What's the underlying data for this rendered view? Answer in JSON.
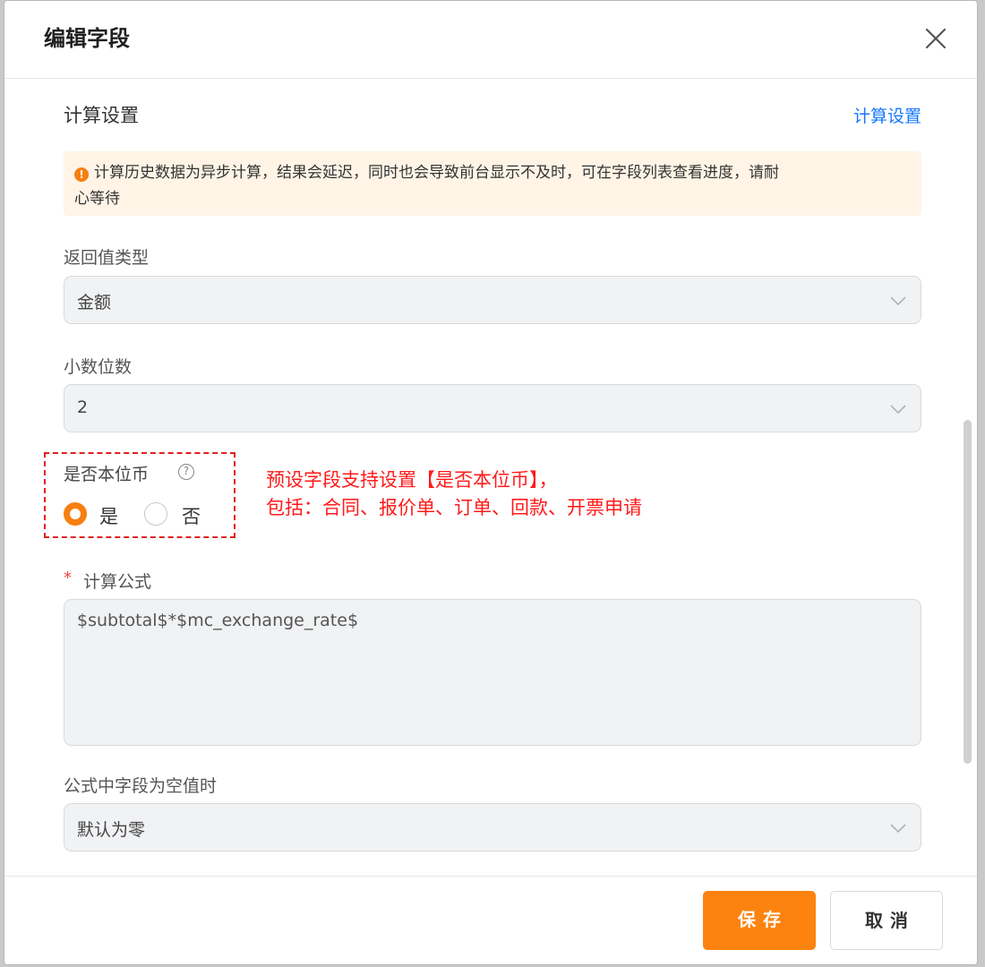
{
  "dialog": {
    "title": "编辑字段"
  },
  "calc_settings": {
    "section_title": "计算设置",
    "link_label": "计算设置",
    "alert_line1": "计算历史数据为异步计算，结果会延迟，同时也会导致前台显示不及时，可在字段列表查看进度，请耐",
    "alert_line2": "心等待",
    "alert_icon": "exclamation-icon",
    "alert_color": "#fff4e6"
  },
  "return_type": {
    "label": "返回值类型",
    "value": "金额"
  },
  "decimals": {
    "label": "小数位数",
    "value": "2"
  },
  "base_currency": {
    "label": "是否本位币",
    "help_icon": "question-circle-icon",
    "options": [
      "是",
      "否"
    ],
    "selected": "是"
  },
  "annotation": {
    "line1": "预设字段支持设置【是否本位币】，",
    "line2": "包括：合同、报价单、订单、回款、开票申请",
    "color": "#ff1a1a"
  },
  "formula": {
    "required_mark": "*",
    "label": "计算公式",
    "value": "$subtotal$*$mc_exchange_rate$"
  },
  "empty_handling": {
    "label": "公式中字段为空值时",
    "value": "默认为零"
  },
  "footer": {
    "save_label": "保存",
    "cancel_label": "取消",
    "primary_color": "#fc830f"
  }
}
